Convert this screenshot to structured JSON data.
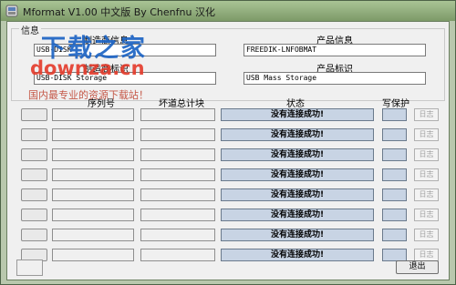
{
  "window": {
    "title": "Mformat V1.00 中文版 By Chenfnu 汉化"
  },
  "info_group": {
    "label": "信息",
    "maker_label": "制造商信息",
    "maker_value": "USB-DISK",
    "product_info_label": "产品信息",
    "product_info_value": "FREEDIK-LNFOBMAT",
    "serial_label": "制造商标识",
    "serial_value": "USB-DISK Storage",
    "product_id_label": "产品标识",
    "product_id_value": "USB Mass Storage"
  },
  "table": {
    "col_serial": "序列号",
    "col_bad_blocks": "坏道总计块",
    "col_status": "状态",
    "col_write_protect": "写保护",
    "rows": [
      {
        "status": "没有连接成功!",
        "log": "日志"
      },
      {
        "status": "没有连接成功!",
        "log": "日志"
      },
      {
        "status": "没有连接成功!",
        "log": "日志"
      },
      {
        "status": "没有连接成功!",
        "log": "日志"
      },
      {
        "status": "没有连接成功!",
        "log": "日志"
      },
      {
        "status": "没有连接成功!",
        "log": "日志"
      },
      {
        "status": "没有连接成功!",
        "log": "日志"
      },
      {
        "status": "没有连接成功!",
        "log": "日志"
      }
    ]
  },
  "exit_label": "退出",
  "watermark": {
    "line1": "下载之家",
    "line2": "downza.cn",
    "line3": "国内最专业的资源下载站！"
  },
  "colors": {
    "status_fill": "#c8d4e4",
    "titlebar": "#8fae7c"
  },
  "icons": {
    "app": "app-icon"
  }
}
